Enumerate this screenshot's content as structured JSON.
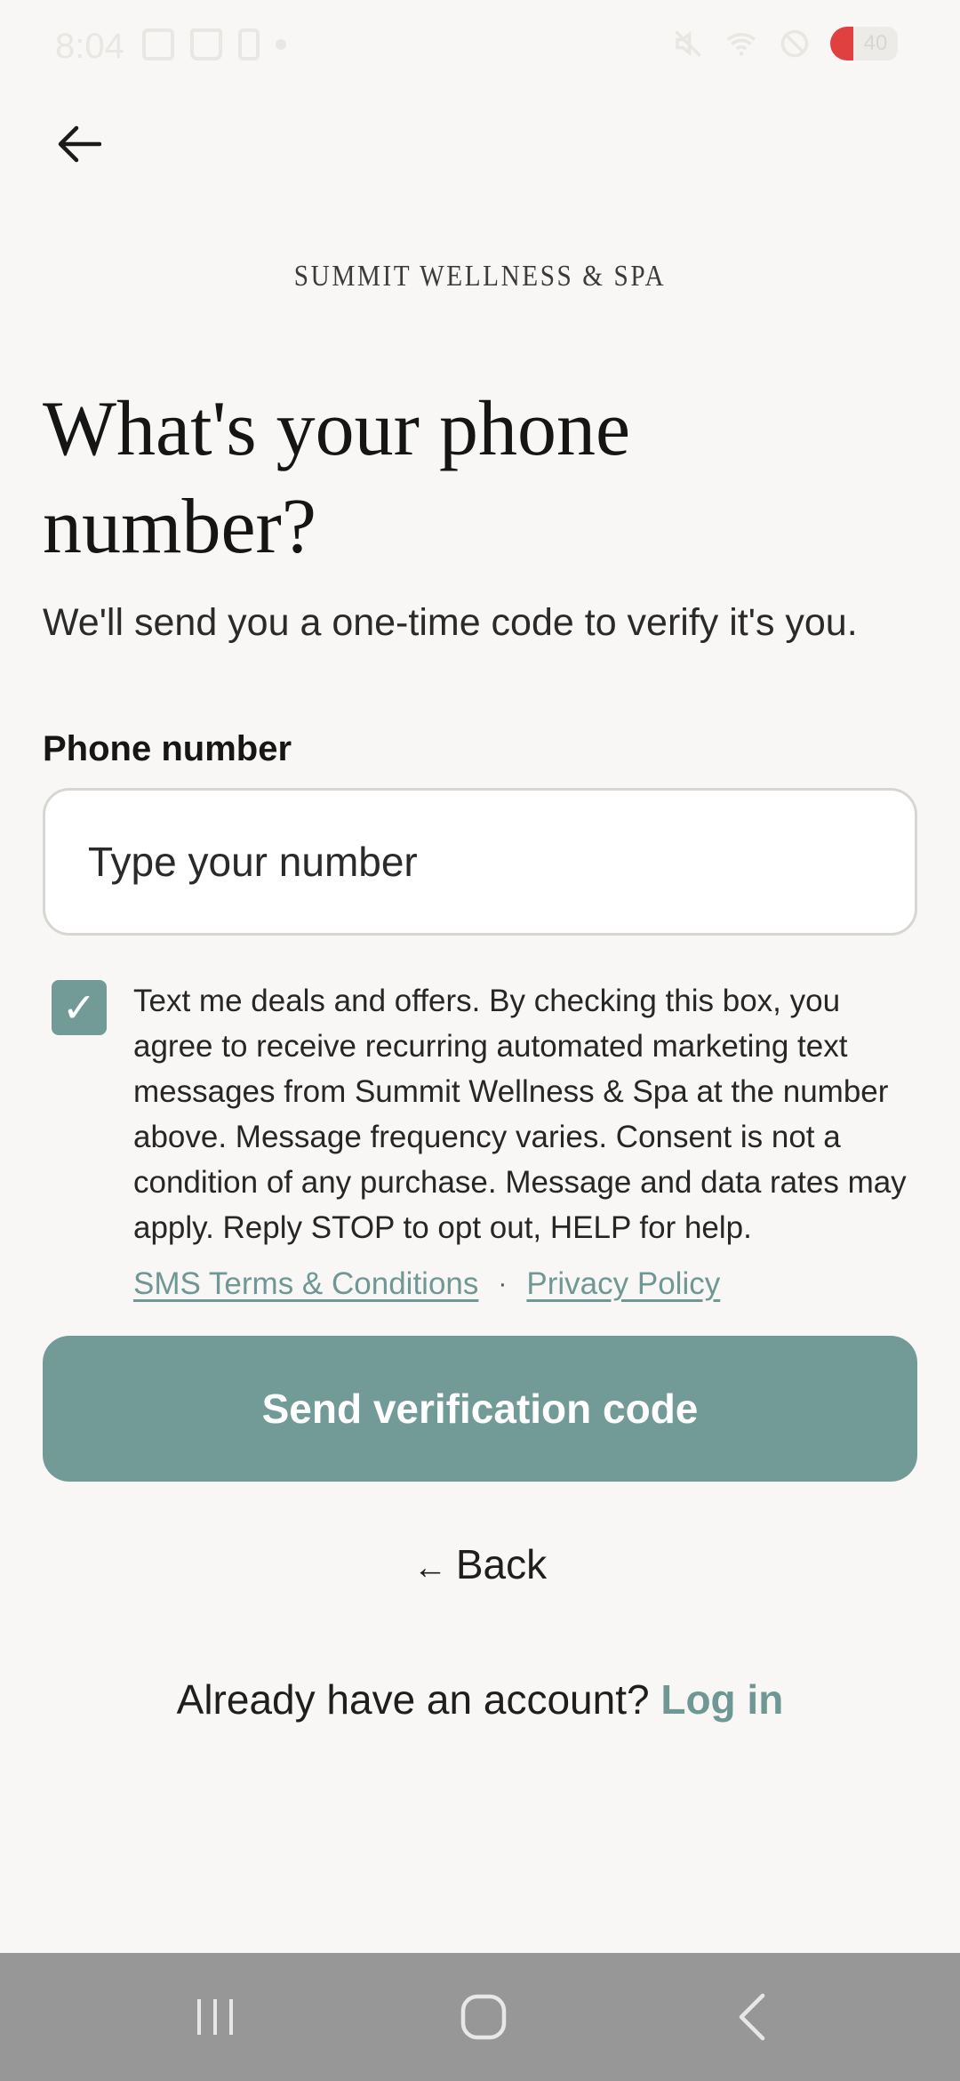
{
  "status_bar": {
    "time": "8:04",
    "battery_level": "40"
  },
  "brand": {
    "name": "SUMMIT WELLNESS & SPA"
  },
  "page": {
    "headline": "What's your phone number?",
    "subtitle": "We'll send you a one-time code to verify it's you."
  },
  "phone_field": {
    "label": "Phone number",
    "placeholder": "Type your number",
    "value": ""
  },
  "consent": {
    "checked": true,
    "check_glyph": "✓",
    "text": "Text me deals and offers. By checking this box, you agree to receive recurring automated marketing text messages from Summit Wellness & Spa at the number above. Message frequency varies. Consent is not a condition of any purchase. Message and data rates may apply. Reply STOP to opt out, HELP for help.",
    "terms_link": "SMS Terms & Conditions",
    "separator": "·",
    "privacy_link": "Privacy Policy"
  },
  "actions": {
    "send_button": "Send verification code",
    "back_arrow": "←",
    "back_label": "Back",
    "login_prompt": "Already have an account?",
    "login_link": "Log in"
  },
  "colors": {
    "accent": "#729b97",
    "link": "#6f9894",
    "background": "#f8f7f5",
    "nav_bar": "#979797"
  },
  "icons": {
    "top_back": "arrow-left-icon",
    "nav_recents": "recents-icon",
    "nav_home": "home-icon",
    "nav_back": "chevron-left-icon"
  }
}
